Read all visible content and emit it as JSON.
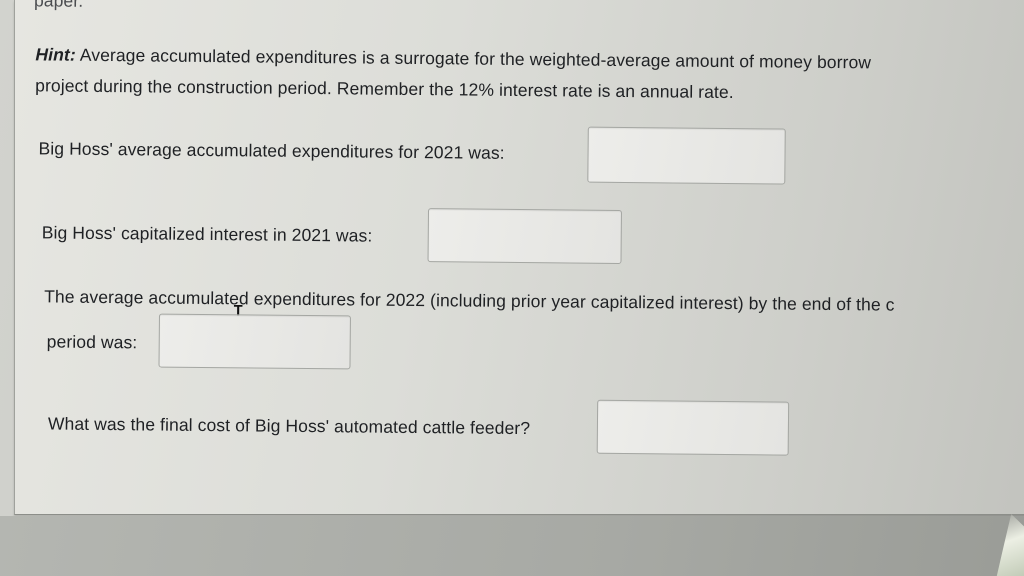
{
  "previous_text": "paper.",
  "hint": {
    "label": "Hint:",
    "line1": " Average accumulated expenditures is a surrogate for the weighted-average amount of money borrow",
    "line2": "project during the construction period. Remember the 12% interest rate is an annual rate."
  },
  "questions": {
    "q1": {
      "label": "Big Hoss' average accumulated expenditures for 2021 was:",
      "value": ""
    },
    "q2": {
      "label": "Big Hoss' capitalized interest in 2021 was:",
      "value": ""
    },
    "q3": {
      "label_part1": "The average accumulate",
      "label_part2": "d expenditures for 2022 (including prior year capitalized interest) by the end of the c",
      "label_line2": "period was:",
      "value": ""
    },
    "q4": {
      "label": "What was the final cost of Big Hoss' automated cattle feeder?",
      "value": ""
    }
  },
  "cursor_glyph": "I",
  "colors": {
    "panel": "#e2e3de",
    "text": "#1f2124",
    "input_border": "#a5a7a3",
    "background": "#8f918c"
  }
}
